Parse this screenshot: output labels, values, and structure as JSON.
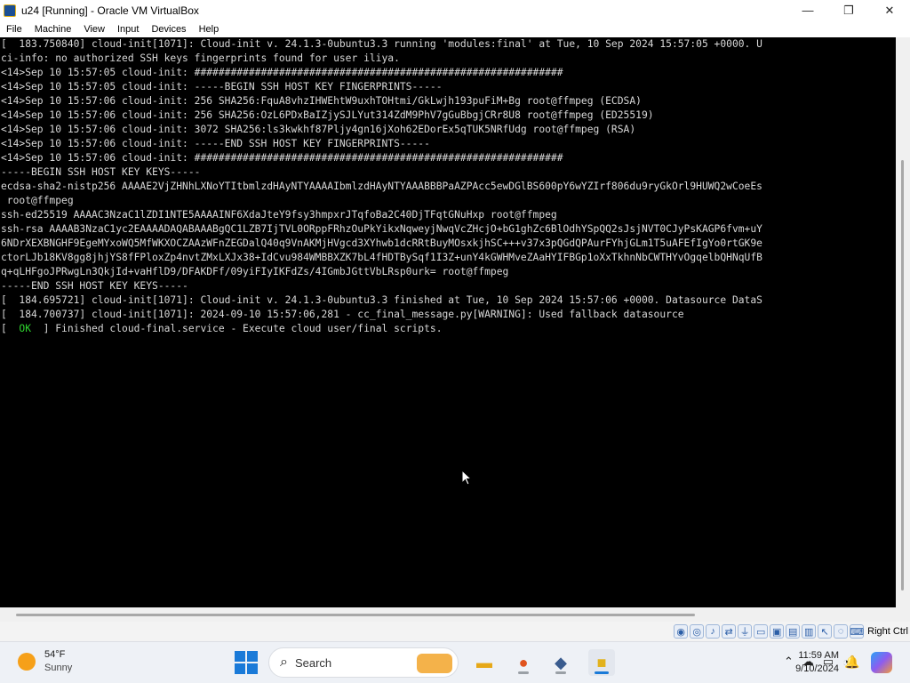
{
  "window": {
    "title": "u24 [Running] - Oracle VM VirtualBox",
    "minimize_glyph": "—",
    "maximize_glyph": "❐",
    "close_glyph": "✕"
  },
  "menu": [
    "File",
    "Machine",
    "View",
    "Input",
    "Devices",
    "Help"
  ],
  "console": {
    "lines": [
      "[  183.750840] cloud-init[1071]: Cloud-init v. 24.1.3-0ubuntu3.3 running 'modules:final' at Tue, 10 Sep 2024 15:57:05 +0000. U",
      "ci-info: no authorized SSH keys fingerprints found for user iliya.",
      "<14>Sep 10 15:57:05 cloud-init: #############################################################",
      "<14>Sep 10 15:57:05 cloud-init: -----BEGIN SSH HOST KEY FINGERPRINTS-----",
      "<14>Sep 10 15:57:06 cloud-init: 256 SHA256:FquA8vhzIHWEhtW9uxhTOHtmi/GkLwjh193puFiM+Bg root@ffmpeg (ECDSA)",
      "<14>Sep 10 15:57:06 cloud-init: 256 SHA256:OzL6PDxBaIZjySJLYut314ZdM9PhV7gGuBbgjCRr8U8 root@ffmpeg (ED25519)",
      "<14>Sep 10 15:57:06 cloud-init: 3072 SHA256:ls3kwkhf87Pljy4gn16jXoh62EDorEx5qTUK5NRfUdg root@ffmpeg (RSA)",
      "<14>Sep 10 15:57:06 cloud-init: -----END SSH HOST KEY FINGERPRINTS-----",
      "<14>Sep 10 15:57:06 cloud-init: #############################################################",
      "-----BEGIN SSH HOST KEY KEYS-----",
      "ecdsa-sha2-nistp256 AAAAE2VjZHNhLXNoYTItbmlzdHAyNTYAAAAIbmlzdHAyNTYAAABBBPaAZPAcc5ewDGlBS600pY6wYZIrf806du9ryGkOrl9HUWQ2wCoeEs",
      " root@ffmpeg",
      "ssh-ed25519 AAAAC3NzaC1lZDI1NTE5AAAAINF6XdaJteY9fsy3hmpxrJTqfoBa2C40DjTFqtGNuHxp root@ffmpeg",
      "ssh-rsa AAAAB3NzaC1yc2EAAAADAQABAAABgQC1LZB7IjTVL0ORppFRhzOuPkYikxNqweyjNwqVcZHcjO+bG1ghZc6BlOdhYSpQQ2sJsjNVT0CJyPsKAGP6fvm+uY",
      "6NDrXEXBNGHF9EgeMYxoWQ5MfWKXOCZAAzWFnZEGDalQ40q9VnAKMjHVgcd3XYhwb1dcRRtBuyMOsxkjhSC+++v37x3pQGdQPAurFYhjGLm1T5uAFEfIgYo0rtGK9e",
      "ctorLJb18KV8gg8jhjYS8fFPloxZp4nvtZMxLXJx38+IdCvu984WMBBXZK7bL4fHDTBySqf1I3Z+unY4kGWHMveZAaHYIFBGp1oXxTkhnNbCWTHYvOgqelbQHNqUfB",
      "q+qLHFgoJPRwgLn3QkjId+vaHflD9/DFAKDFf/09yiFIyIKFdZs/4IGmbJGttVbLRsp0urk= root@ffmpeg",
      "-----END SSH HOST KEY KEYS-----",
      "[  184.695721] cloud-init[1071]: Cloud-init v. 24.1.3-0ubuntu3.3 finished at Tue, 10 Sep 2024 15:57:06 +0000. Datasource DataS",
      "[  184.700737] cloud-init[1071]: 2024-09-10 15:57:06,281 - cc_final_message.py[WARNING]: Used fallback datasource"
    ],
    "final_line": {
      "prefix": "[  ",
      "status": "OK",
      "rest": "  ] Finished cloud-final.service - Execute cloud user/final scripts."
    }
  },
  "statusbar": {
    "icons": [
      "hard-disk-icon",
      "optical-drive-icon",
      "audio-icon",
      "network-icon",
      "usb-icon",
      "shared-folder-icon",
      "display-icon",
      "recording-icon",
      "capture-icon",
      "mouse-integration-icon",
      "cpu-icon",
      "keyboard-icon"
    ],
    "host_key": "Right Ctrl"
  },
  "taskbar": {
    "weather": {
      "temp": "54°F",
      "condition": "Sunny"
    },
    "search_placeholder": "Search",
    "apps": [
      "file-explorer-icon",
      "firefox-icon",
      "virtualbox-icon",
      "virtualbox-vm-icon"
    ],
    "clock": {
      "time": "11:59 AM",
      "date": "9/10/2024"
    }
  },
  "colors": {
    "console_bg": "#000000",
    "console_text": "#d8d8d8",
    "ok_green": "#2fd42f",
    "accent": "#1a7ad8"
  }
}
